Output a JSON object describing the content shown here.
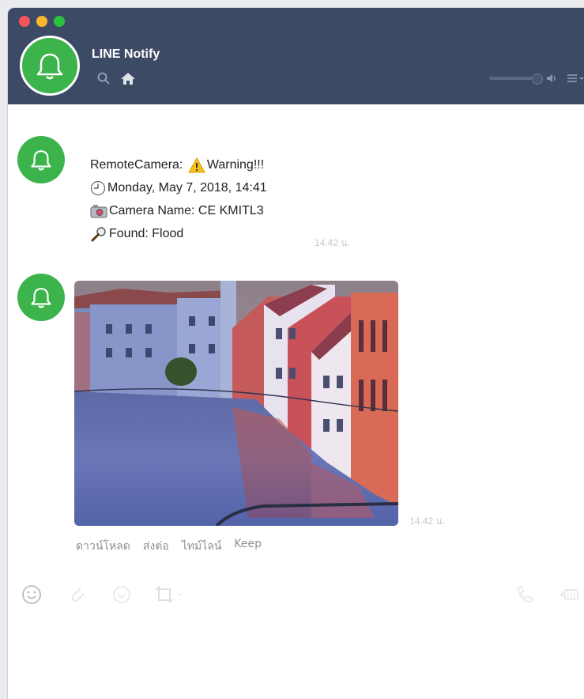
{
  "window": {
    "title": "LINE Notify"
  },
  "header": {
    "icons": [
      "search-icon",
      "home-icon"
    ],
    "right_icons": [
      "volume-icon",
      "menu-icon"
    ]
  },
  "messages": [
    {
      "sender": "LINE Notify",
      "lines": [
        {
          "emoji": "warning",
          "prefix": "RemoteCamera: ",
          "text": "Warning!!!"
        },
        {
          "emoji": "clock",
          "prefix": "",
          "text": "Monday, May 7, 2018, 14:41"
        },
        {
          "emoji": "camera",
          "prefix": "",
          "text": "Camera Name: CE KMITL3"
        },
        {
          "emoji": "magnifier",
          "prefix": "",
          "text": "Found: Flood"
        }
      ],
      "time": "14.42 น."
    },
    {
      "sender": "LINE Notify",
      "type": "image",
      "time": "14.42 น.",
      "actions": [
        "ดาวน์โหลด",
        "ส่งต่อ",
        "ไทม์ไลน์",
        "Keep"
      ]
    }
  ],
  "input_bar": {
    "icons": [
      "emoji-icon",
      "attach-icon",
      "sticker-icon",
      "crop-icon",
      "call-icon",
      "video-icon"
    ]
  },
  "colors": {
    "titlebar": "#3d4a66",
    "avatar": "#3cb44b",
    "background": "#ffffff"
  }
}
